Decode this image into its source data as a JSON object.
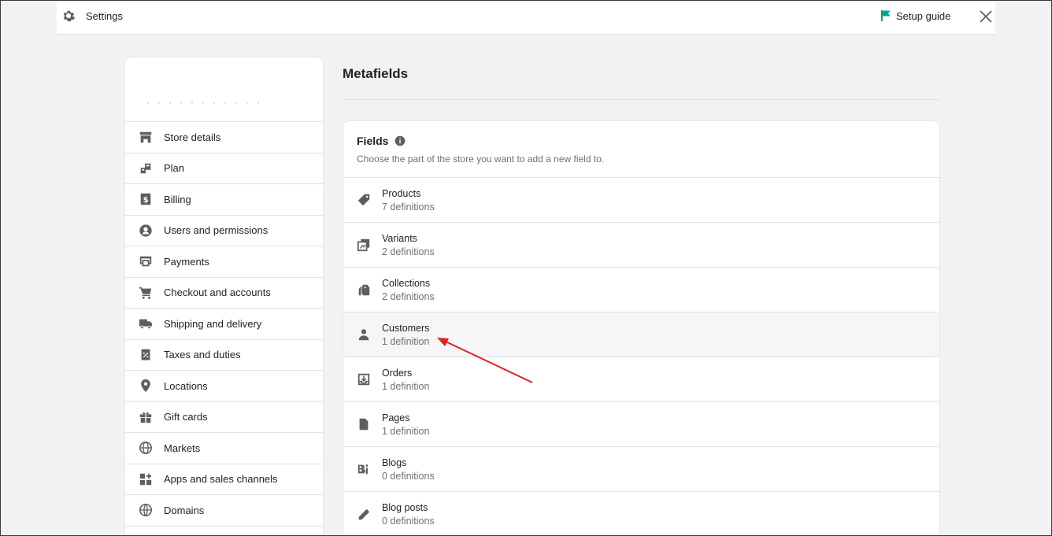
{
  "topbar": {
    "title": "Settings",
    "setup_guide": "Setup guide",
    "accent": "#008060"
  },
  "sidebar": {
    "items": [
      {
        "label": "Store details",
        "icon": "store-icon"
      },
      {
        "label": "Plan",
        "icon": "plan-icon"
      },
      {
        "label": "Billing",
        "icon": "billing-icon"
      },
      {
        "label": "Users and permissions",
        "icon": "user-circle-icon"
      },
      {
        "label": "Payments",
        "icon": "payments-icon"
      },
      {
        "label": "Checkout and accounts",
        "icon": "cart-icon"
      },
      {
        "label": "Shipping and delivery",
        "icon": "truck-icon"
      },
      {
        "label": "Taxes and duties",
        "icon": "tax-icon"
      },
      {
        "label": "Locations",
        "icon": "location-pin-icon"
      },
      {
        "label": "Gift cards",
        "icon": "gift-icon"
      },
      {
        "label": "Markets",
        "icon": "globe-icon"
      },
      {
        "label": "Apps and sales channels",
        "icon": "apps-icon"
      },
      {
        "label": "Domains",
        "icon": "domains-icon"
      }
    ]
  },
  "main": {
    "title": "Metafields"
  },
  "fields": {
    "title": "Fields",
    "description": "Choose the part of the store you want to add a new field to.",
    "rows": [
      {
        "name": "Products",
        "count": "7 definitions",
        "icon": "tag-icon"
      },
      {
        "name": "Variants",
        "count": "2 definitions",
        "icon": "variants-icon"
      },
      {
        "name": "Collections",
        "count": "2 definitions",
        "icon": "collections-icon"
      },
      {
        "name": "Customers",
        "count": "1 definition",
        "icon": "person-icon"
      },
      {
        "name": "Orders",
        "count": "1 definition",
        "icon": "orders-icon"
      },
      {
        "name": "Pages",
        "count": "1 definition",
        "icon": "page-icon"
      },
      {
        "name": "Blogs",
        "count": "0 definitions",
        "icon": "blog-icon"
      },
      {
        "name": "Blog posts",
        "count": "0 definitions",
        "icon": "pencil-icon"
      }
    ]
  },
  "annotation_color": "#e02020"
}
